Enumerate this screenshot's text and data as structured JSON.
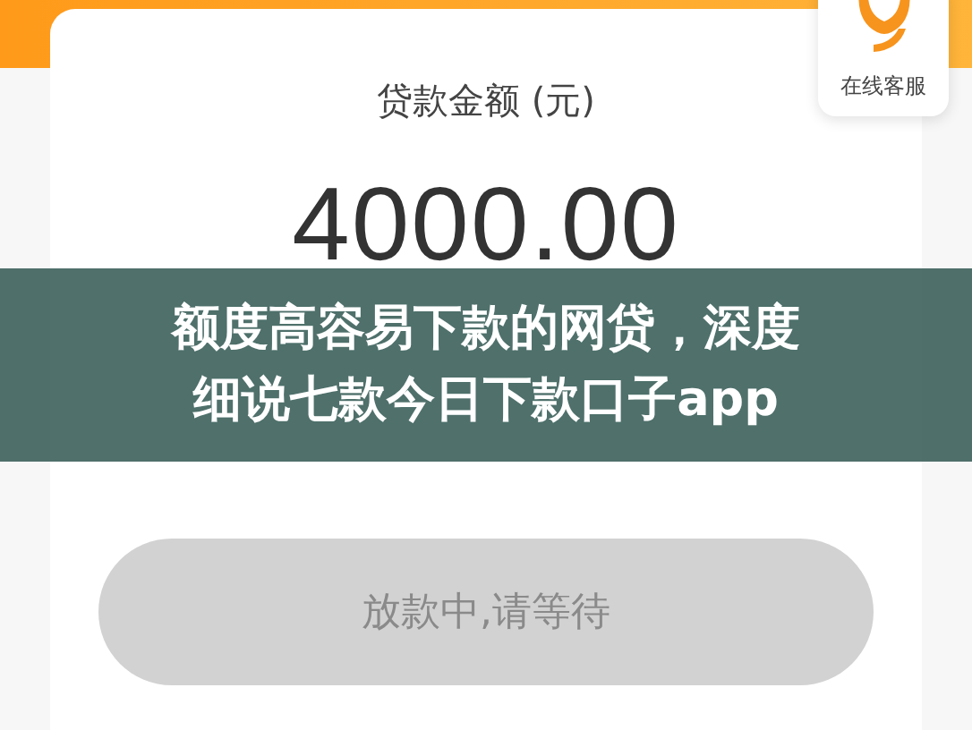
{
  "loan": {
    "label": "贷款金额 (元)",
    "amount": "4000.00"
  },
  "service": {
    "label": "在线客服"
  },
  "banner": {
    "lines": [
      "额度高容易下款的网贷，深度",
      "细说七款今日下款口子app"
    ]
  },
  "button": {
    "label": "放款中,请等待",
    "disabled": true
  }
}
